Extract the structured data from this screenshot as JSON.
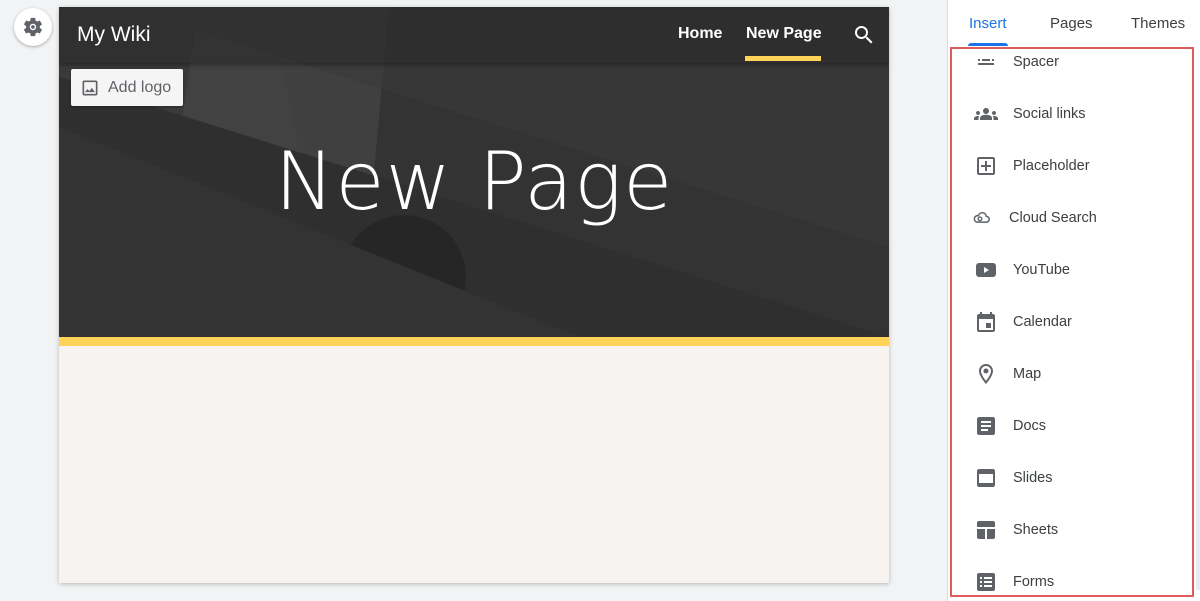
{
  "site": {
    "title": "My Wiki",
    "add_logo_label": "Add logo",
    "hero_title": "New Page"
  },
  "nav": {
    "items": [
      {
        "label": "Home",
        "icon": "none"
      },
      {
        "label": "New Page",
        "icon": "none",
        "active": true
      }
    ],
    "search_icon": "search-icon"
  },
  "panel": {
    "tabs": [
      {
        "label": "Insert",
        "active": true
      },
      {
        "label": "Pages"
      },
      {
        "label": "Themes"
      }
    ],
    "insert_items": [
      {
        "label": "Spacer",
        "icon": "spacer-icon"
      },
      {
        "label": "Social links",
        "icon": "people-icon"
      },
      {
        "label": "Placeholder",
        "icon": "add-box-icon"
      },
      {
        "label": "Cloud Search",
        "icon": "cloud-search-icon"
      },
      {
        "label": "YouTube",
        "icon": "youtube-icon"
      },
      {
        "label": "Calendar",
        "icon": "calendar-icon"
      },
      {
        "label": "Map",
        "icon": "map-pin-icon"
      },
      {
        "label": "Docs",
        "icon": "docs-icon"
      },
      {
        "label": "Slides",
        "icon": "slides-icon"
      },
      {
        "label": "Sheets",
        "icon": "sheets-icon"
      },
      {
        "label": "Forms",
        "icon": "forms-icon"
      }
    ]
  },
  "colors": {
    "accent": "#ffd25a",
    "tab_active": "#1a73e8",
    "highlight_border": "#e05c5c",
    "hero_bg": "#333333"
  }
}
